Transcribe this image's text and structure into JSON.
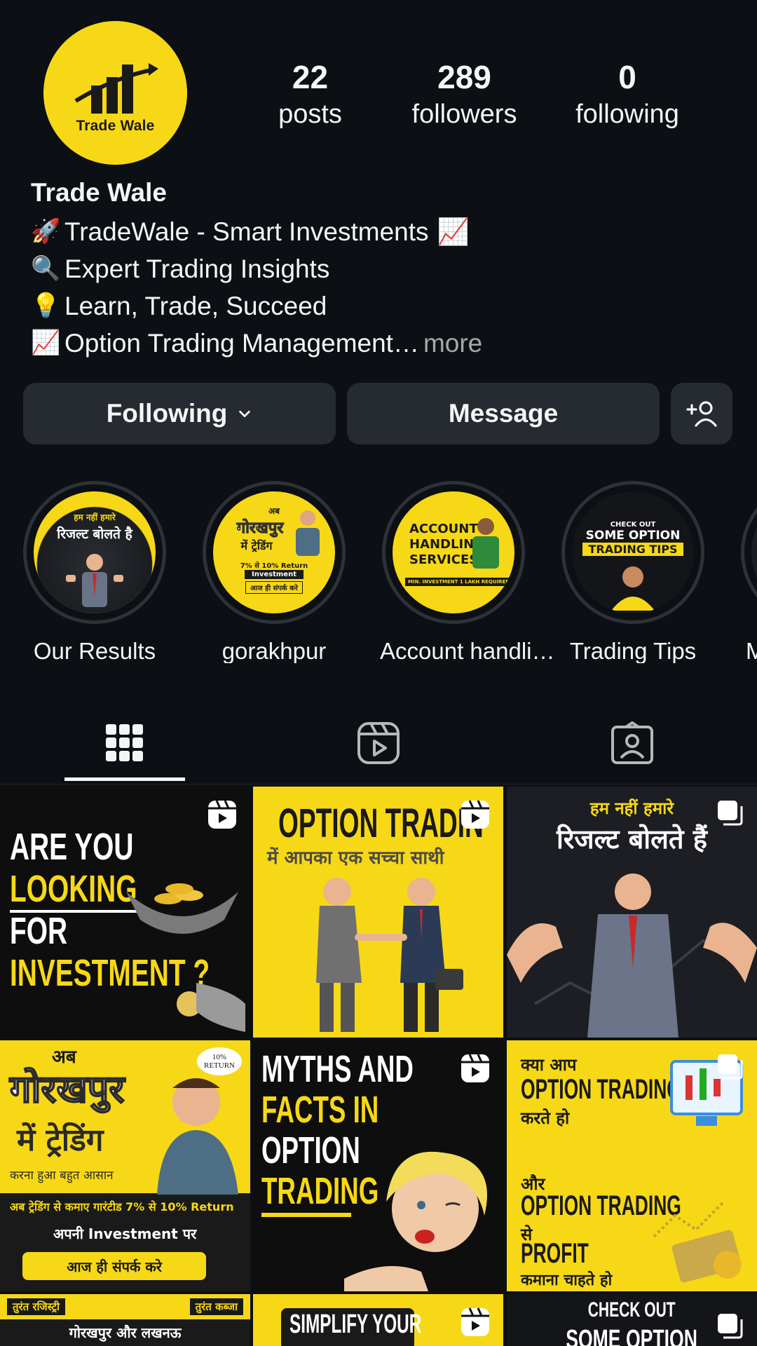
{
  "profile": {
    "avatar_text": "Trade Wale",
    "name": "Trade Wale",
    "stats": [
      {
        "value": "22",
        "label": "posts"
      },
      {
        "value": "289",
        "label": "followers"
      },
      {
        "value": "0",
        "label": "following"
      }
    ],
    "bio": [
      {
        "emoji": "🚀",
        "text": "TradeWale - Smart Investments",
        "trail": "📈"
      },
      {
        "emoji": "🔍",
        "text": "Expert Trading Insights",
        "trail": ""
      },
      {
        "emoji": "💡",
        "text": "Learn, Trade, Succeed",
        "trail": ""
      },
      {
        "emoji": "📈",
        "text": "Option Trading Management…",
        "trail": ""
      }
    ],
    "bio_more": "more"
  },
  "actions": {
    "following": "Following",
    "message": "Message"
  },
  "highlights": [
    {
      "label": "Our Results",
      "cover_lines": [
        "हम नहीं हमारे",
        "रिजल्ट बोलते है"
      ]
    },
    {
      "label": "gorakhpur",
      "cover_lines": [
        "अब",
        "गोरखपुर",
        "में ट्रेडिंग",
        "7% से 10% Return",
        "Investment",
        "आज ही संपर्क करे"
      ]
    },
    {
      "label": "Account handli…",
      "cover_lines": [
        "ACCOUNT",
        "HANDLING",
        "SERVICES",
        "MIN. INVESTMENT 1 LAKH REQUIRED"
      ]
    },
    {
      "label": "Trading Tips",
      "cover_lines": [
        "CHECK OUT",
        "SOME OPTION",
        "TRADING TIPS"
      ]
    },
    {
      "label": "M",
      "cover_lines": []
    }
  ],
  "posts": [
    {
      "lines": [
        "ARE YOU",
        "LOOKING",
        "FOR",
        "INVESTMENT ?"
      ],
      "type": "reel"
    },
    {
      "lines": [
        "OPTION TRADIN",
        "में आपका एक सच्चा साथी"
      ],
      "type": "reel"
    },
    {
      "lines": [
        "हम नहीं हमारे",
        "रिजल्ट बोलते हैं"
      ],
      "type": "carousel"
    },
    {
      "lines": [
        "अब",
        "गोरखपुर",
        "में ट्रेडिंग",
        "करना हुआ बहुत आसान",
        "अब ट्रेडिंग से कमाए गारंटीड 7% से 10% Return",
        "अपनी Investment पर",
        "आज ही संपर्क करे",
        "10% RETURN"
      ],
      "type": "none"
    },
    {
      "lines": [
        "MYTHS AND",
        "FACTS IN",
        "OPTION",
        "TRADING"
      ],
      "type": "reel"
    },
    {
      "lines": [
        "क्या आप",
        "OPTION TRADING",
        "करते हो",
        "और",
        "OPTION TRADING",
        "से",
        "PROFIT",
        "कमाना चाहते हो"
      ],
      "type": "carousel"
    },
    {
      "lines": [
        "तुरंत रजिस्ट्री",
        "तुरंत कब्जा",
        "गोरखपुर और लखनऊ"
      ],
      "type": "none"
    },
    {
      "lines": [
        "SIMPLIFY YOUR"
      ],
      "type": "reel"
    },
    {
      "lines": [
        "CHECK OUT",
        "SOME OPTION"
      ],
      "type": "carousel"
    }
  ],
  "colors": {
    "background": "#0c0f14",
    "button": "#262a31",
    "brand_yellow": "#f7d816",
    "muted": "#a8a8a8"
  },
  "icons": [
    "chevron-down-icon",
    "add-user-icon",
    "grid-icon",
    "reels-icon",
    "tagged-icon",
    "reel-icon",
    "carousel-icon"
  ]
}
